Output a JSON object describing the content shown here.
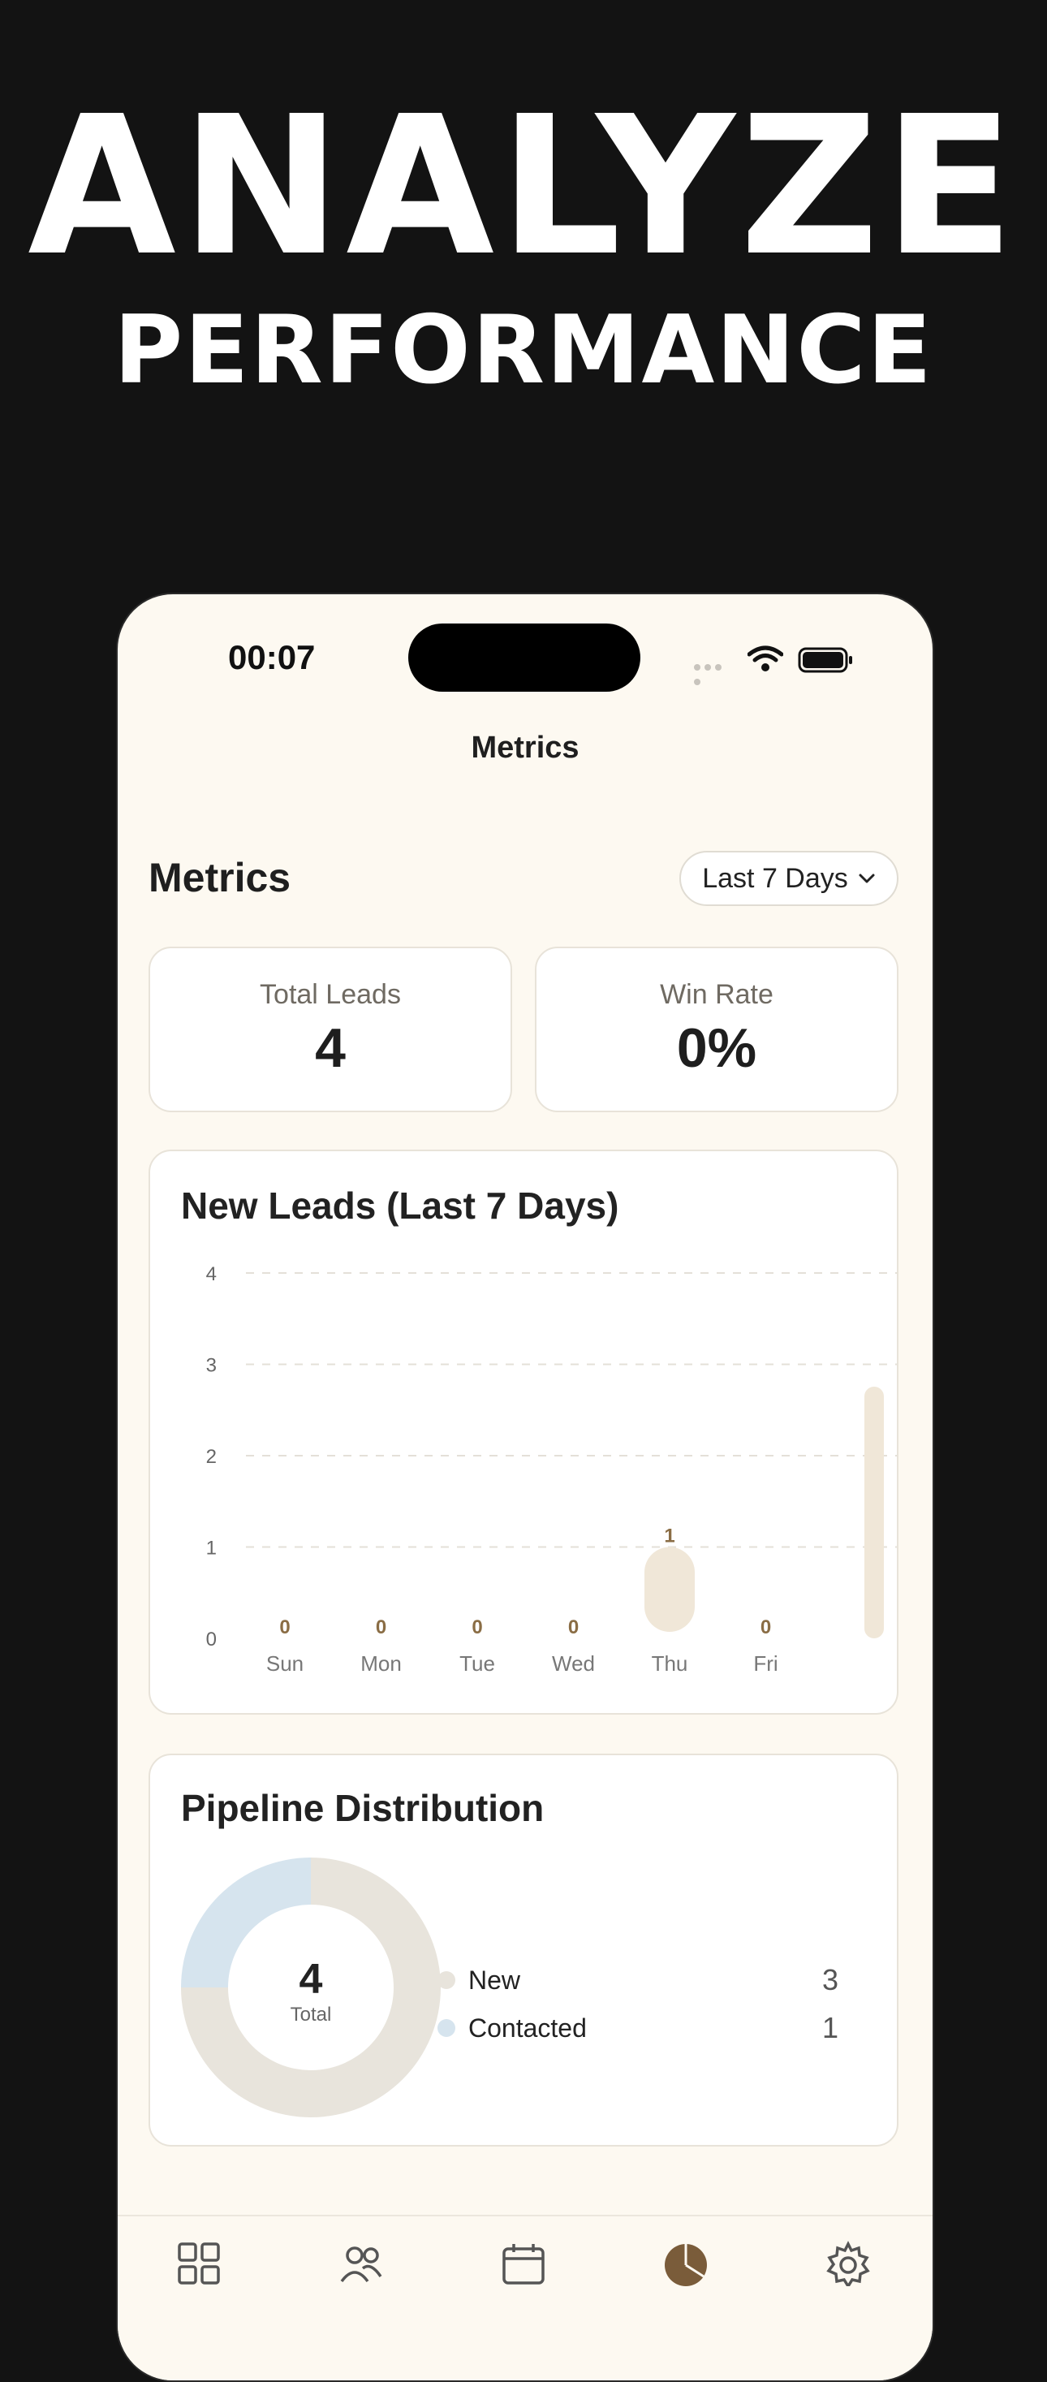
{
  "promo": {
    "headline": "ANALYZE",
    "subheadline": "PERFORMANCE"
  },
  "status_bar": {
    "time": "00:07"
  },
  "nav": {
    "title": "Metrics"
  },
  "metrics": {
    "title": "Metrics",
    "range_label": "Last 7 Days",
    "total_leads": {
      "label": "Total Leads",
      "value": "4"
    },
    "win_rate": {
      "label": "Win Rate",
      "value": "0%"
    }
  },
  "chart_data": [
    {
      "type": "bar",
      "title": "New Leads (Last 7 Days)",
      "categories": [
        "Sun",
        "Mon",
        "Tue",
        "Wed",
        "Thu",
        "Fri"
      ],
      "values": [
        0,
        0,
        0,
        0,
        1,
        0
      ],
      "ylim": [
        0,
        4
      ],
      "yticks": [
        "0",
        "1",
        "2",
        "3",
        "4"
      ],
      "grid": true
    },
    {
      "type": "pie",
      "title": "Pipeline Distribution",
      "center_value": "4",
      "center_label": "Total",
      "series": [
        {
          "name": "New",
          "value": 3,
          "count": "3",
          "color": "#e8e4dc"
        },
        {
          "name": "Contacted",
          "value": 1,
          "count": "1",
          "color": "#d6e4ee"
        }
      ]
    }
  ],
  "tabbar": {
    "items": [
      {
        "icon": "dashboard-icon"
      },
      {
        "icon": "people-icon"
      },
      {
        "icon": "calendar-icon"
      },
      {
        "icon": "pie-chart-icon",
        "active": true
      },
      {
        "icon": "gear-icon"
      }
    ]
  },
  "colors": {
    "bar": "#f0e7d8",
    "value_label": "#8a6d45",
    "active_tab": "#7a5c3a"
  }
}
